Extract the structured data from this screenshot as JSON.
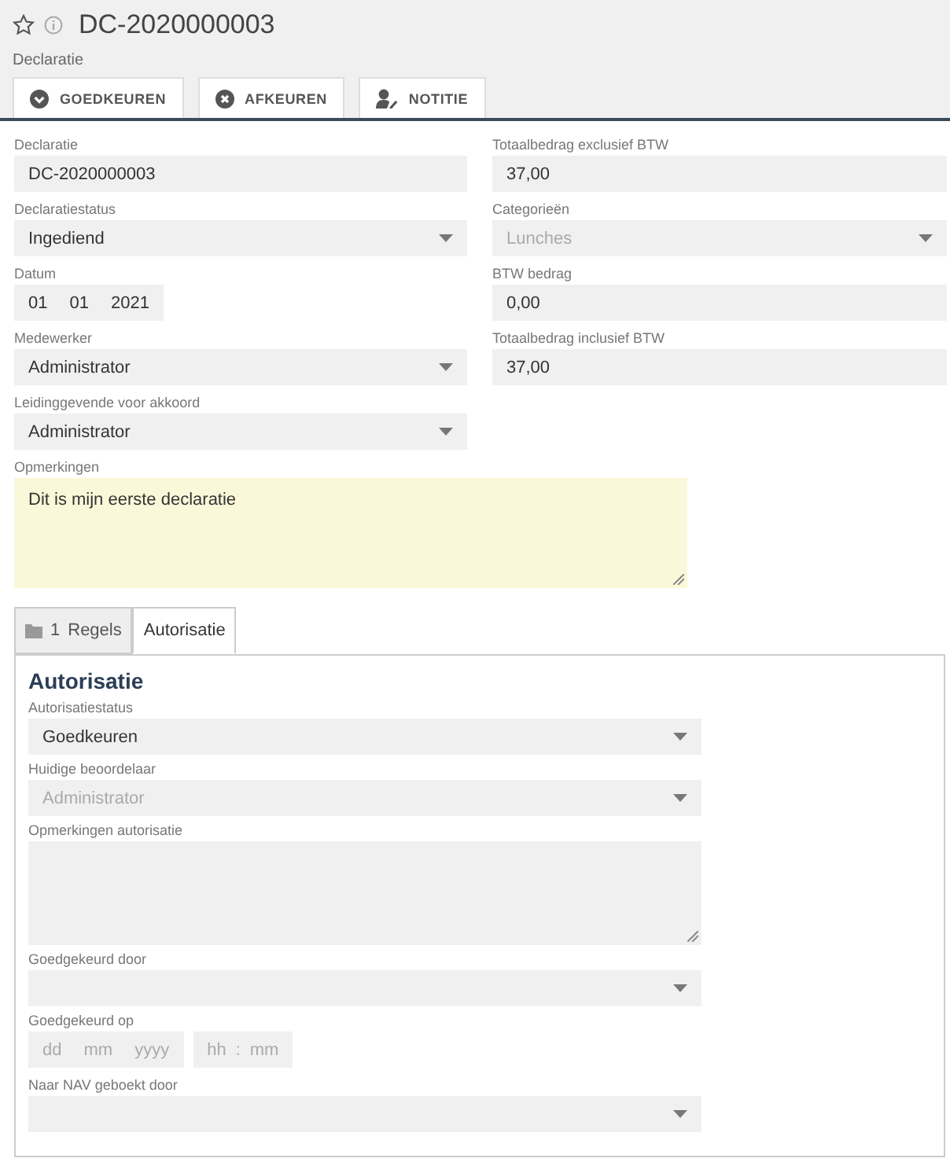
{
  "header": {
    "title": "DC-2020000003",
    "subtitle": "Declaratie"
  },
  "actions": [
    {
      "kind": "approve",
      "label": "GOEDKEUREN"
    },
    {
      "kind": "reject",
      "label": "AFKEUREN"
    },
    {
      "kind": "note",
      "label": "NOTITIE"
    }
  ],
  "left_fields": [
    {
      "kind": "text",
      "label": "Declaratie",
      "value": "DC-2020000003"
    },
    {
      "kind": "select",
      "label": "Declaratiestatus",
      "value": "Ingediend",
      "disabled": false
    },
    {
      "kind": "date",
      "label": "Datum",
      "day": "01",
      "month": "01",
      "year": "2021"
    },
    {
      "kind": "select",
      "label": "Medewerker",
      "value": "Administrator",
      "disabled": false
    },
    {
      "kind": "select",
      "label": "Leidinggevende voor akkoord",
      "value": "Administrator",
      "disabled": false
    }
  ],
  "right_fields": [
    {
      "kind": "text",
      "label": "Totaalbedrag exclusief BTW",
      "value": "37,00"
    },
    {
      "kind": "select",
      "label": "Categorieën",
      "value": "Lunches",
      "disabled": true
    },
    {
      "kind": "text",
      "label": "BTW bedrag",
      "value": "0,00"
    },
    {
      "kind": "text",
      "label": "Totaalbedrag inclusief BTW",
      "value": "37,00"
    }
  ],
  "remarks": {
    "label": "Opmerkingen",
    "value": "Dit is mijn eerste declaratie"
  },
  "tabs": [
    {
      "count": "1",
      "label": "Regels",
      "selected": false
    },
    {
      "label": "Autorisatie",
      "selected": true
    }
  ],
  "panel": {
    "heading": "Autorisatie",
    "fields": [
      {
        "kind": "select",
        "label": "Autorisatiestatus",
        "value": "Goedkeuren",
        "disabled": false
      },
      {
        "kind": "select",
        "label": "Huidige beoordelaar",
        "value": "Administrator",
        "disabled": true
      },
      {
        "kind": "textarea",
        "label": "Opmerkingen autorisatie"
      },
      {
        "kind": "select",
        "label": "Goedgekeurd door"
      },
      {
        "kind": "datetime",
        "label": "Goedgekeurd op",
        "day": "dd",
        "month": "mm",
        "year": "yyyy",
        "hour": "hh",
        "separator": ":",
        "minute": "mm"
      },
      {
        "kind": "select",
        "label": "Naar NAV geboekt door"
      }
    ]
  }
}
